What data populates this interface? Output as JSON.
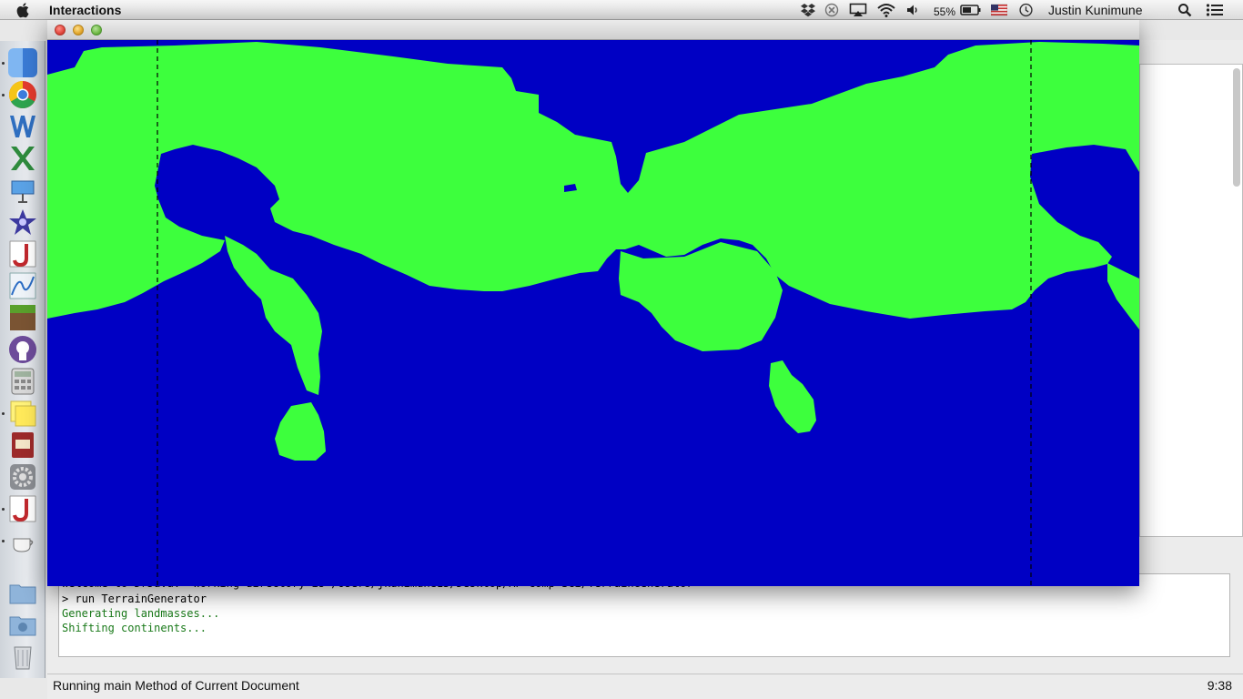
{
  "menubar": {
    "app_name": "Interactions",
    "battery_percent": "55%",
    "user_name": "Justin Kunimune"
  },
  "dock": {
    "items": [
      "finder-icon",
      "chrome-icon",
      "word-icon",
      "excel-icon",
      "keynote-icon",
      "imovie-icon",
      "drjava-icon",
      "grapher-icon",
      "minecraft-icon",
      "github-icon",
      "calculator-icon",
      "stickies-icon",
      "dictionary-icon",
      "system-preferences-icon",
      "drjava-icon",
      "java-icon",
      "applications-folder-icon",
      "downloads-folder-icon",
      "trash-icon"
    ]
  },
  "console": {
    "lines": [
      {
        "text": "Welcome to DrJava.  Working directory is /Users/jkunimune15/Desktop/AP Comp Sci/TerrainGenerator",
        "color": "#333333"
      },
      {
        "text": "> run TerrainGenerator",
        "color": "#111111"
      },
      {
        "text": "Generating landmasses...",
        "color": "#1a7a1a"
      },
      {
        "text": "Shifting continents...",
        "color": "#1a7a1a"
      }
    ]
  },
  "status": {
    "text": "Running main Method of Current Document",
    "time": "9:38"
  },
  "colors": {
    "ocean": "#0000c4",
    "land": "#3dff3d"
  }
}
